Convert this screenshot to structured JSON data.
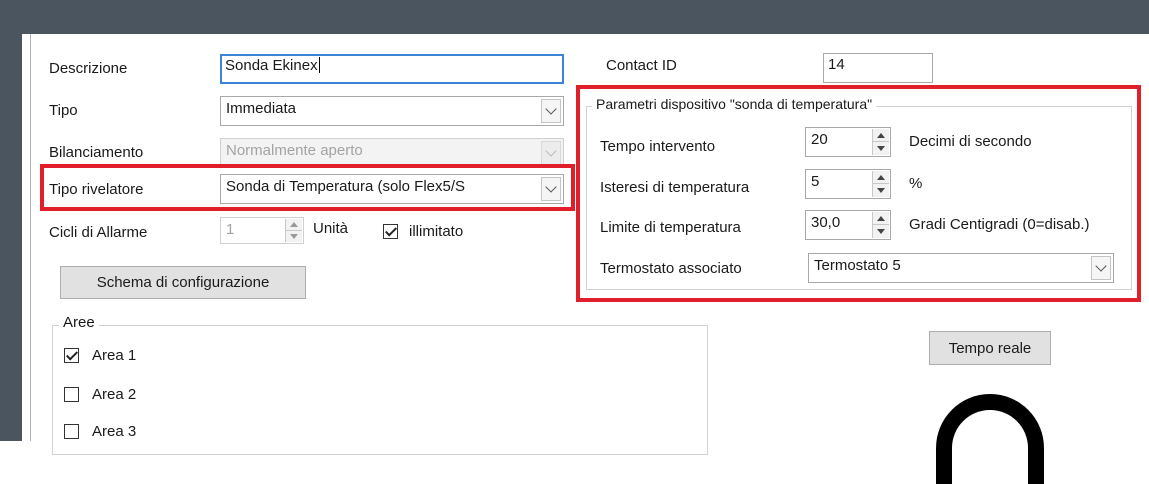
{
  "form": {
    "descrizione": {
      "label": "Descrizione",
      "value": "Sonda Ekinex"
    },
    "contact_id": {
      "label": "Contact ID",
      "value": "14"
    },
    "tipo": {
      "label": "Tipo",
      "value": "Immediata"
    },
    "bilanciamento": {
      "label": "Bilanciamento",
      "value": "Normalmente aperto"
    },
    "tipo_rivelatore": {
      "label": "Tipo rivelatore",
      "value": "Sonda di Temperatura (solo  Flex5/S"
    },
    "cicli": {
      "label": "Cicli di Allarme",
      "value": "1",
      "unit": "Unità",
      "illimitato_label": "illimitato",
      "illimitato_checked": true
    },
    "schema_button": "Schema di configurazione"
  },
  "parametri": {
    "title": "Parametri dispositivo \"sonda di temperatura\"",
    "tempo_intervento": {
      "label": "Tempo intervento",
      "value": "20",
      "unit": "Decimi di secondo"
    },
    "isteresi": {
      "label": "Isteresi di temperatura",
      "value": "5",
      "unit": "%"
    },
    "limite": {
      "label": "Limite di temperatura",
      "value": "30,0",
      "unit": "Gradi Centigradi (0=disab.)"
    },
    "termostato": {
      "label": "Termostato associato",
      "value": "Termostato 5"
    }
  },
  "aree": {
    "title": "Aree",
    "items": [
      {
        "label": "Area 1",
        "checked": true
      },
      {
        "label": "Area 2",
        "checked": false
      },
      {
        "label": "Area 3",
        "checked": false
      }
    ]
  },
  "tempo_reale_button": "Tempo reale",
  "colors": {
    "highlight": "#e01f2a",
    "titlebar": "#4a5560",
    "focus": "#3b84d8"
  }
}
